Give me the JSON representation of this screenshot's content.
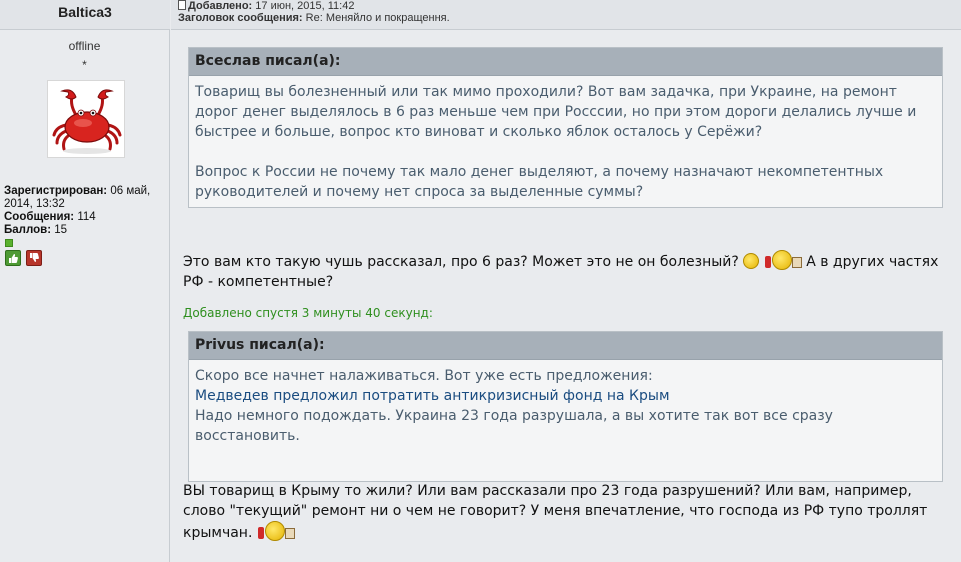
{
  "author": {
    "name": "Baltica3",
    "status": "offline",
    "rank": "*",
    "registered_label": "Зарегистрирован:",
    "registered_value": "06 май, 2014, 13:32",
    "messages_label": "Сообщения:",
    "messages_value": "114",
    "points_label": "Баллов:",
    "points_value": "15"
  },
  "post_header": {
    "added_label": "Добавлено:",
    "added_value": "17 июн, 2015, 11:42",
    "subject_label": "Заголовок сообщения:",
    "subject_value": "Re: Меняйло и покращення."
  },
  "quote1": {
    "title": "Всеслав писал(а):",
    "p1": "Товарищ вы болезненный или так мимо проходили? Вот вам задачка, при Украине, на ремонт дорог денег выделялось в 6 раз меньше чем при Росссии, но при этом дороги делались лучше и быстрее и больше, вопрос кто виноват и сколько яблок осталось у Серёжи?",
    "p2": "Вопрос к России не почему так мало денег выделяют, а почему назначают некомпетентных руководителей и почему нет спроса за выделенные суммы?"
  },
  "reply1": {
    "text_before": "Это вам кто такую чушь рассказал, про 6 раз? Может это не он болезный?",
    "text_after": "А в других частях РФ - компетентные?"
  },
  "added_later": "Добавлено спустя 3 минуты 40 секунд:",
  "quote2": {
    "title": "Privus писал(а):",
    "line1": "Скоро все начнет налаживаться. Вот уже есть предложения:",
    "link": "Медведев предложил потратить антикризисный фонд на Крым",
    "line3": "Надо немного подождать. Украина 23 года разрушала, а вы хотите так вот все сразу восстановить."
  },
  "reply2": {
    "text": "ВЫ товарищ в Крыму то жили? Или вам рассказали про 23 года разрушений? Или вам, например, слово \"текущий\" ремонт ни о чем не говорит? У меня впечатление, что господа из РФ тупо троллят крымчан."
  },
  "icons": [
    "doc-icon",
    "crab-avatar",
    "thumbs-up-icon",
    "thumbs-down-icon",
    "smiley-icon",
    "drinking-smiley-icon"
  ],
  "colors": {
    "accent_green": "#2f8f1f",
    "quote_header": "#a7b0b9",
    "link": "#1a4c80"
  }
}
